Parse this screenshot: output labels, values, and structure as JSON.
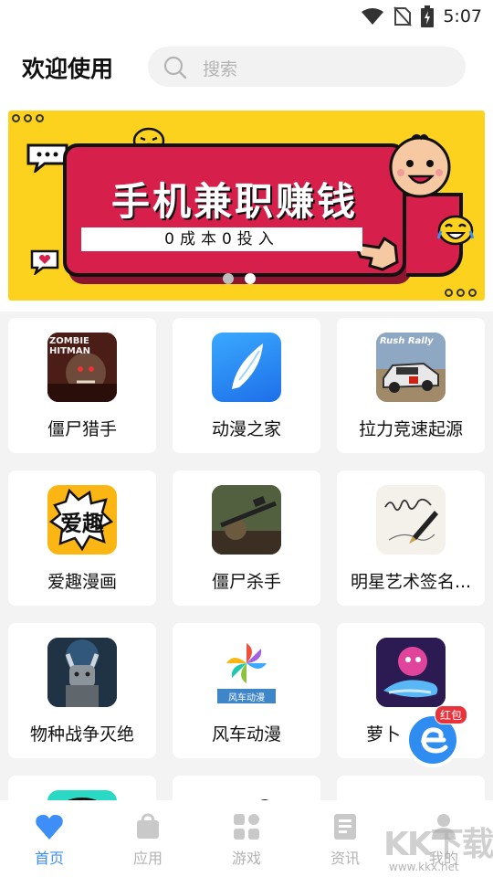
{
  "status_bar": {
    "time": "5:07",
    "icons": [
      "wifi-icon",
      "no-sim-icon",
      "battery-charging-icon"
    ]
  },
  "header": {
    "welcome": "欢迎使用",
    "search_placeholder": "搜索",
    "search_icon": "search-icon"
  },
  "banner": {
    "title": "手机兼职赚钱",
    "subtitle": "0成本0投入",
    "slide_count": 2,
    "active_slide": 2,
    "colors": {
      "background": "#fcd21e",
      "panel": "#d61f4a"
    }
  },
  "apps": [
    {
      "name": "僵尸猎手",
      "icon": "zombie-hunter-icon",
      "icon_text": "ZOMBIE HITMAN"
    },
    {
      "name": "动漫之家",
      "icon": "feather-wing-icon"
    },
    {
      "name": "拉力竞速起源",
      "icon": "rally-car-icon",
      "icon_text": "Rush Rally"
    },
    {
      "name": "爱趣漫画",
      "icon": "aiqu-comic-icon",
      "icon_text": "爱趣"
    },
    {
      "name": "僵尸杀手",
      "icon": "sniper-soldier-icon"
    },
    {
      "name": "明星艺术签名...",
      "icon": "signature-pen-icon"
    },
    {
      "name": "物种战争灭绝",
      "icon": "armored-creature-icon"
    },
    {
      "name": "风车动漫",
      "icon": "pinwheel-icon",
      "icon_text": "风车动漫"
    },
    {
      "name": "萝卜",
      "icon": "dolphin-icon"
    },
    {
      "name": "",
      "icon": "partial-app-icon-1"
    },
    {
      "name": "",
      "icon": "partial-app-icon-2"
    },
    {
      "name": "",
      "icon": "partial-app-icon-3"
    }
  ],
  "floating": {
    "label": "红包",
    "icon": "red-packet-e-icon"
  },
  "bottom_nav": [
    {
      "label": "首页",
      "icon": "heart-diamond-icon",
      "active": true
    },
    {
      "label": "应用",
      "icon": "bag-icon",
      "active": false
    },
    {
      "label": "游戏",
      "icon": "grid-apps-icon",
      "active": false
    },
    {
      "label": "资讯",
      "icon": "news-icon",
      "active": false
    },
    {
      "label": "我的",
      "icon": "user-icon",
      "active": false
    }
  ],
  "watermark": {
    "text": "KK下载",
    "url": "www.kkx.net"
  },
  "colors": {
    "accent": "#3d8ef6",
    "inactive": "#b3b3b3",
    "page_bg": "#f3f3f3"
  }
}
